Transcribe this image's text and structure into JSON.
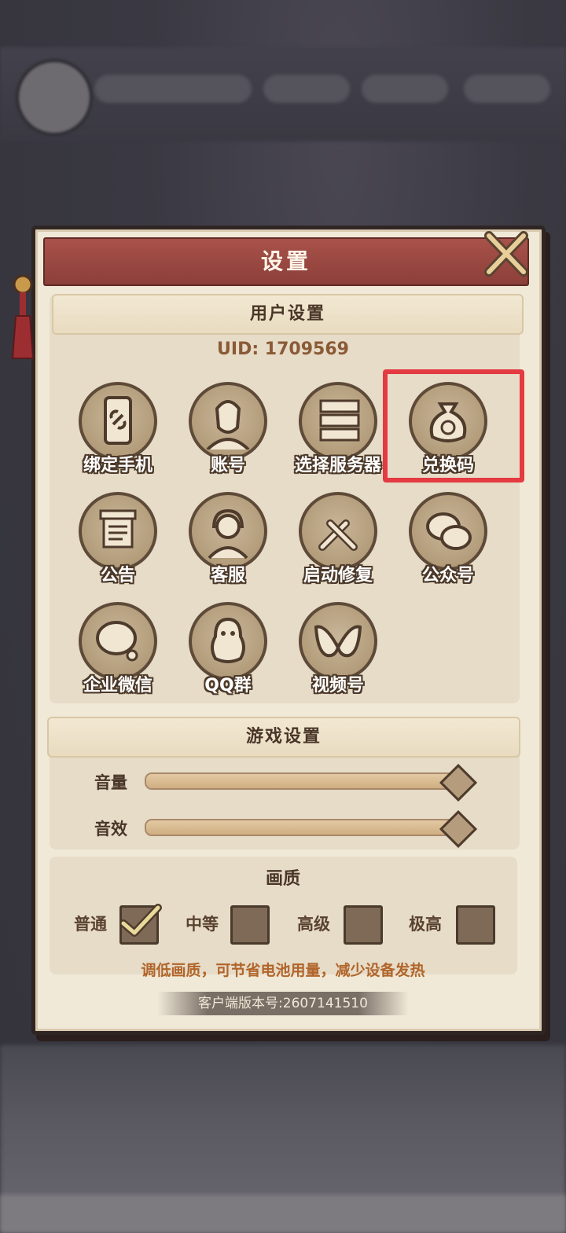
{
  "dialog": {
    "title": "设置"
  },
  "user_settings": {
    "title": "用户设置",
    "uid": "UID: 1709569",
    "buttons": [
      {
        "label": "绑定手机",
        "icon": "phone-link-icon"
      },
      {
        "label": "账号",
        "icon": "character-portrait-icon"
      },
      {
        "label": "选择服务器",
        "icon": "server-icon"
      },
      {
        "label": "兑换码",
        "icon": "money-bag-icon"
      },
      {
        "label": "公告",
        "icon": "notice-board-icon"
      },
      {
        "label": "客服",
        "icon": "headset-agent-icon"
      },
      {
        "label": "启动修复",
        "icon": "wrench-tools-icon"
      },
      {
        "label": "公众号",
        "icon": "wechat-icon"
      },
      {
        "label": "企业微信",
        "icon": "enterprise-wechat-icon"
      },
      {
        "label": "QQ群",
        "icon": "qq-penguin-icon"
      },
      {
        "label": "视频号",
        "icon": "channels-icon"
      }
    ]
  },
  "game_settings": {
    "title": "游戏设置",
    "volume_label": "音量",
    "volume_value": 1.0,
    "sfx_label": "音效",
    "sfx_value": 1.0
  },
  "quality": {
    "title": "画质",
    "options": [
      {
        "label": "普通",
        "checked": true
      },
      {
        "label": "中等",
        "checked": false
      },
      {
        "label": "高级",
        "checked": false
      },
      {
        "label": "极高",
        "checked": false
      }
    ],
    "hint": "调低画质，可节省电池用量，减少设备发热"
  },
  "version": "客户端版本号:2607141510",
  "colors": {
    "highlight": "#e43a41",
    "header": "#8c3f39"
  }
}
